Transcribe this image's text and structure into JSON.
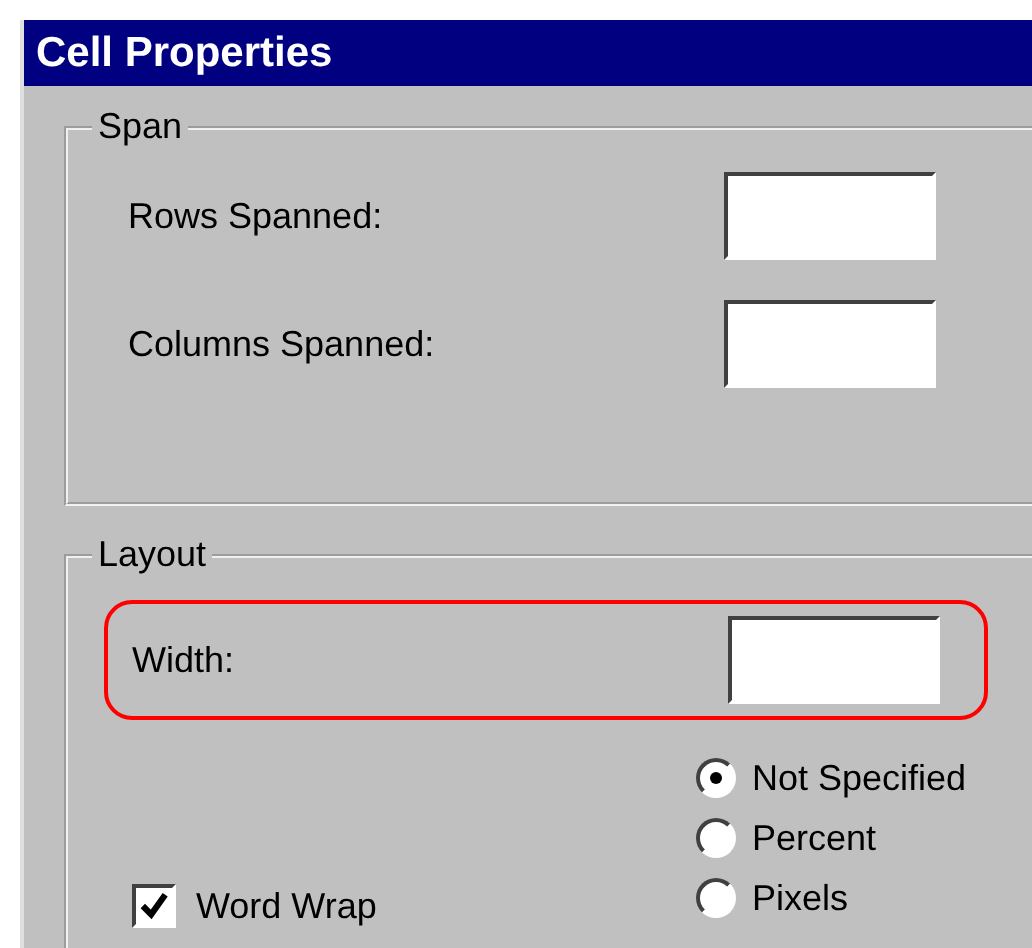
{
  "window": {
    "title": "Cell Properties"
  },
  "span": {
    "legend": "Span",
    "fields": [
      {
        "label": "Rows Spanned:"
      },
      {
        "label": "Columns Spanned:"
      }
    ]
  },
  "layout": {
    "legend": "Layout",
    "width": {
      "label": "Width:",
      "highlighted": true
    },
    "width_units": [
      {
        "label": "Not Specified",
        "selected": true
      },
      {
        "label": "Percent",
        "selected": false
      },
      {
        "label": "Pixels",
        "selected": false
      }
    ],
    "word_wrap": {
      "label": "Word Wrap",
      "checked": true
    }
  }
}
